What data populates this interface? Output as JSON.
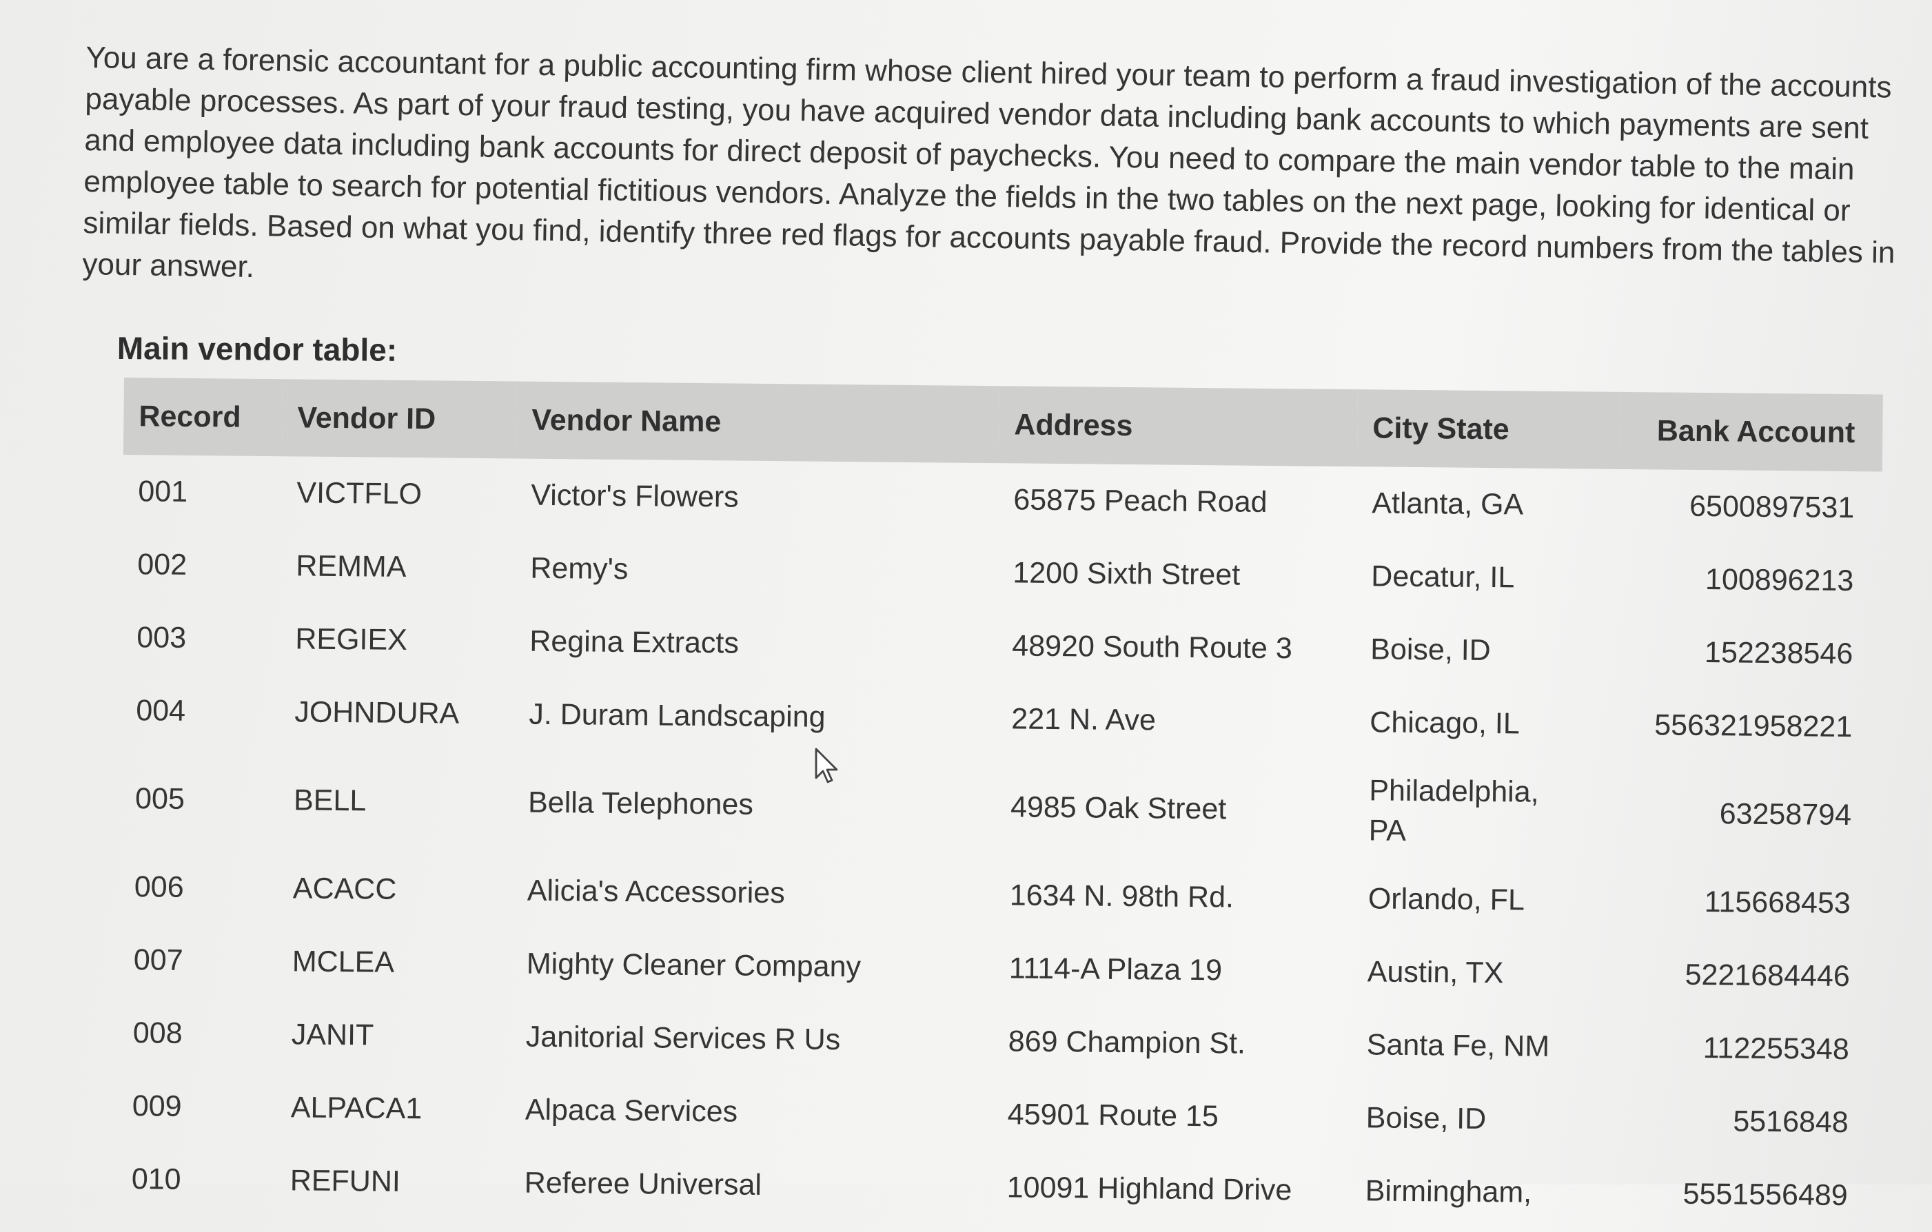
{
  "question": {
    "text": "You are a forensic accountant for a public accounting firm whose client hired your team to perform a fraud investigation of the accounts payable processes. As part of your fraud testing, you have acquired vendor data including bank accounts to which payments are sent and employee data including bank accounts for direct deposit of paychecks. You need to compare the main vendor table to the main employee table to search for potential fictitious vendors. Analyze the fields in the two tables on the next page, looking for identical or similar fields. Based on what you find, identify three red flags for accounts payable fraud. Provide the record numbers from the tables in your answer."
  },
  "vendor_table": {
    "title": "Main vendor table:",
    "headers": {
      "record": "Record",
      "vendor_id": "Vendor ID",
      "vendor_name": "Vendor Name",
      "address": "Address",
      "city_state": "City State",
      "bank_account": "Bank Account"
    },
    "rows": [
      {
        "record": "001",
        "vendor_id": "VICTFLO",
        "vendor_name": "Victor's Flowers",
        "address": "65875 Peach Road",
        "city_state": "Atlanta, GA",
        "bank_account": "6500897531"
      },
      {
        "record": "002",
        "vendor_id": "REMMA",
        "vendor_name": "Remy's",
        "address": "1200 Sixth Street",
        "city_state": "Decatur, IL",
        "bank_account": "100896213"
      },
      {
        "record": "003",
        "vendor_id": "REGIEX",
        "vendor_name": "Regina Extracts",
        "address": "48920 South Route 3",
        "city_state": "Boise, ID",
        "bank_account": "152238546"
      },
      {
        "record": "004",
        "vendor_id": "JOHNDURA",
        "vendor_name": "J. Duram Landscaping",
        "address": "221 N. Ave",
        "city_state": "Chicago, IL",
        "bank_account": "556321958221"
      },
      {
        "record": "005",
        "vendor_id": "BELL",
        "vendor_name": "Bella Telephones",
        "address": "4985 Oak Street",
        "city_state": "Philadelphia, PA",
        "bank_account": "63258794"
      },
      {
        "record": "006",
        "vendor_id": "ACACC",
        "vendor_name": "Alicia's Accessories",
        "address": "1634 N. 98th Rd.",
        "city_state": "Orlando, FL",
        "bank_account": "115668453"
      },
      {
        "record": "007",
        "vendor_id": "MCLEA",
        "vendor_name": "Mighty Cleaner Company",
        "address": "1114-A Plaza 19",
        "city_state": "Austin, TX",
        "bank_account": "5221684446"
      },
      {
        "record": "008",
        "vendor_id": "JANIT",
        "vendor_name": "Janitorial Services R Us",
        "address": "869 Champion St.",
        "city_state": "Santa Fe, NM",
        "bank_account": "112255348"
      },
      {
        "record": "009",
        "vendor_id": "ALPACA1",
        "vendor_name": "Alpaca Services",
        "address": "45901 Route 15",
        "city_state": "Boise, ID",
        "bank_account": "5516848"
      },
      {
        "record": "010",
        "vendor_id": "REFUNI",
        "vendor_name": "Referee Universal",
        "address": "10091 Highland Drive",
        "city_state": "Birmingham,",
        "bank_account": "5551556489"
      }
    ]
  },
  "cursor": {
    "icon": "mouse-pointer-icon"
  }
}
